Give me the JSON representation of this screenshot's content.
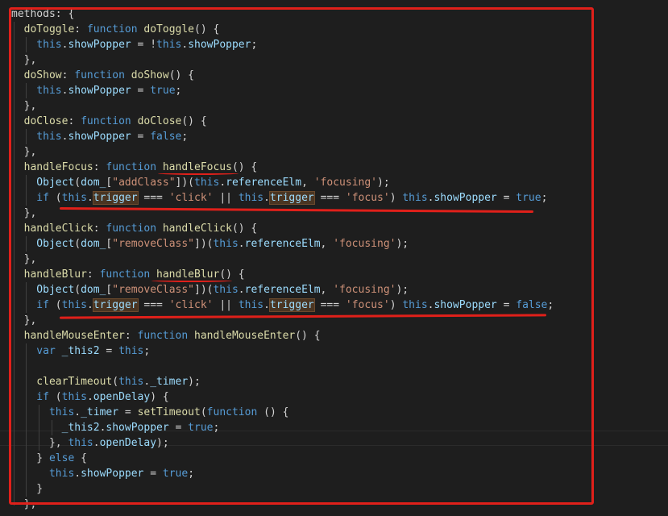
{
  "editor": {
    "lines": [
      [
        {
          "t": "methods",
          "c": "k-plain"
        },
        {
          "t": ": {",
          "c": "k-plain"
        }
      ],
      [
        {
          "t": "  doToggle",
          "c": "k-fn"
        },
        {
          "t": ": ",
          "c": "k-plain"
        },
        {
          "t": "function ",
          "c": "k-kw"
        },
        {
          "t": "doToggle",
          "c": "k-fn"
        },
        {
          "t": "() {",
          "c": "k-plain"
        }
      ],
      [
        {
          "t": "    this",
          "c": "k-kw"
        },
        {
          "t": ".",
          "c": "k-plain"
        },
        {
          "t": "showPopper",
          "c": "k-prop"
        },
        {
          "t": " = !",
          "c": "k-plain"
        },
        {
          "t": "this",
          "c": "k-kw"
        },
        {
          "t": ".",
          "c": "k-plain"
        },
        {
          "t": "showPopper",
          "c": "k-prop"
        },
        {
          "t": ";",
          "c": "k-plain"
        }
      ],
      [
        {
          "t": "  },",
          "c": "k-plain"
        }
      ],
      [
        {
          "t": "  doShow",
          "c": "k-fn"
        },
        {
          "t": ": ",
          "c": "k-plain"
        },
        {
          "t": "function ",
          "c": "k-kw"
        },
        {
          "t": "doShow",
          "c": "k-fn"
        },
        {
          "t": "() {",
          "c": "k-plain"
        }
      ],
      [
        {
          "t": "    this",
          "c": "k-kw"
        },
        {
          "t": ".",
          "c": "k-plain"
        },
        {
          "t": "showPopper",
          "c": "k-prop"
        },
        {
          "t": " = ",
          "c": "k-plain"
        },
        {
          "t": "true",
          "c": "k-lit"
        },
        {
          "t": ";",
          "c": "k-plain"
        }
      ],
      [
        {
          "t": "  },",
          "c": "k-plain"
        }
      ],
      [
        {
          "t": "  doClose",
          "c": "k-fn"
        },
        {
          "t": ": ",
          "c": "k-plain"
        },
        {
          "t": "function ",
          "c": "k-kw"
        },
        {
          "t": "doClose",
          "c": "k-fn"
        },
        {
          "t": "() {",
          "c": "k-plain"
        }
      ],
      [
        {
          "t": "    this",
          "c": "k-kw"
        },
        {
          "t": ".",
          "c": "k-plain"
        },
        {
          "t": "showPopper",
          "c": "k-prop"
        },
        {
          "t": " = ",
          "c": "k-plain"
        },
        {
          "t": "false",
          "c": "k-lit"
        },
        {
          "t": ";",
          "c": "k-plain"
        }
      ],
      [
        {
          "t": "  },",
          "c": "k-plain"
        }
      ],
      [
        {
          "t": "  handleFocus",
          "c": "k-fn"
        },
        {
          "t": ": ",
          "c": "k-plain"
        },
        {
          "t": "function ",
          "c": "k-kw"
        },
        {
          "t": "handleFocus",
          "c": "k-fn"
        },
        {
          "t": "() {",
          "c": "k-plain"
        }
      ],
      [
        {
          "t": "    Object",
          "c": "k-prop"
        },
        {
          "t": "(",
          "c": "k-plain"
        },
        {
          "t": "dom_",
          "c": "k-prop"
        },
        {
          "t": "[",
          "c": "k-plain"
        },
        {
          "t": "\"addClass\"",
          "c": "k-str"
        },
        {
          "t": "])(",
          "c": "k-plain"
        },
        {
          "t": "this",
          "c": "k-kw"
        },
        {
          "t": ".",
          "c": "k-plain"
        },
        {
          "t": "referenceElm",
          "c": "k-prop"
        },
        {
          "t": ", ",
          "c": "k-plain"
        },
        {
          "t": "'focusing'",
          "c": "k-str"
        },
        {
          "t": ");",
          "c": "k-plain"
        }
      ],
      [
        {
          "t": "    if ",
          "c": "k-kw"
        },
        {
          "t": "(",
          "c": "k-plain"
        },
        {
          "t": "this",
          "c": "k-kw"
        },
        {
          "t": ".",
          "c": "k-plain"
        },
        {
          "t": "trigger",
          "c": "k-prop hl"
        },
        {
          "t": " === ",
          "c": "k-plain"
        },
        {
          "t": "'click'",
          "c": "k-str"
        },
        {
          "t": " || ",
          "c": "k-plain"
        },
        {
          "t": "this",
          "c": "k-kw"
        },
        {
          "t": ".",
          "c": "k-plain"
        },
        {
          "t": "trigger",
          "c": "k-prop hl"
        },
        {
          "t": " === ",
          "c": "k-plain"
        },
        {
          "t": "'focus'",
          "c": "k-str"
        },
        {
          "t": ") ",
          "c": "k-plain"
        },
        {
          "t": "this",
          "c": "k-kw"
        },
        {
          "t": ".",
          "c": "k-plain"
        },
        {
          "t": "showPopper",
          "c": "k-prop"
        },
        {
          "t": " = ",
          "c": "k-plain"
        },
        {
          "t": "true",
          "c": "k-lit"
        },
        {
          "t": ";",
          "c": "k-plain"
        }
      ],
      [
        {
          "t": "  },",
          "c": "k-plain"
        }
      ],
      [
        {
          "t": "  handleClick",
          "c": "k-fn"
        },
        {
          "t": ": ",
          "c": "k-plain"
        },
        {
          "t": "function ",
          "c": "k-kw"
        },
        {
          "t": "handleClick",
          "c": "k-fn"
        },
        {
          "t": "() {",
          "c": "k-plain"
        }
      ],
      [
        {
          "t": "    Object",
          "c": "k-prop"
        },
        {
          "t": "(",
          "c": "k-plain"
        },
        {
          "t": "dom_",
          "c": "k-prop"
        },
        {
          "t": "[",
          "c": "k-plain"
        },
        {
          "t": "\"removeClass\"",
          "c": "k-str"
        },
        {
          "t": "])(",
          "c": "k-plain"
        },
        {
          "t": "this",
          "c": "k-kw"
        },
        {
          "t": ".",
          "c": "k-plain"
        },
        {
          "t": "referenceElm",
          "c": "k-prop"
        },
        {
          "t": ", ",
          "c": "k-plain"
        },
        {
          "t": "'focusing'",
          "c": "k-str"
        },
        {
          "t": ");",
          "c": "k-plain"
        }
      ],
      [
        {
          "t": "  },",
          "c": "k-plain"
        }
      ],
      [
        {
          "t": "  handleBlur",
          "c": "k-fn"
        },
        {
          "t": ": ",
          "c": "k-plain"
        },
        {
          "t": "function ",
          "c": "k-kw"
        },
        {
          "t": "handleBlur",
          "c": "k-fn"
        },
        {
          "t": "() {",
          "c": "k-plain"
        }
      ],
      [
        {
          "t": "    Object",
          "c": "k-prop"
        },
        {
          "t": "(",
          "c": "k-plain"
        },
        {
          "t": "dom_",
          "c": "k-prop"
        },
        {
          "t": "[",
          "c": "k-plain"
        },
        {
          "t": "\"removeClass\"",
          "c": "k-str"
        },
        {
          "t": "])(",
          "c": "k-plain"
        },
        {
          "t": "this",
          "c": "k-kw"
        },
        {
          "t": ".",
          "c": "k-plain"
        },
        {
          "t": "referenceElm",
          "c": "k-prop"
        },
        {
          "t": ", ",
          "c": "k-plain"
        },
        {
          "t": "'focusing'",
          "c": "k-str"
        },
        {
          "t": ");",
          "c": "k-plain"
        }
      ],
      [
        {
          "t": "    if ",
          "c": "k-kw"
        },
        {
          "t": "(",
          "c": "k-plain"
        },
        {
          "t": "this",
          "c": "k-kw"
        },
        {
          "t": ".",
          "c": "k-plain"
        },
        {
          "t": "trigger",
          "c": "k-prop hl"
        },
        {
          "t": " === ",
          "c": "k-plain"
        },
        {
          "t": "'click'",
          "c": "k-str"
        },
        {
          "t": " || ",
          "c": "k-plain"
        },
        {
          "t": "this",
          "c": "k-kw"
        },
        {
          "t": ".",
          "c": "k-plain"
        },
        {
          "t": "trigger",
          "c": "k-prop hl"
        },
        {
          "t": " === ",
          "c": "k-plain"
        },
        {
          "t": "'focus'",
          "c": "k-str"
        },
        {
          "t": ") ",
          "c": "k-plain"
        },
        {
          "t": "this",
          "c": "k-kw"
        },
        {
          "t": ".",
          "c": "k-plain"
        },
        {
          "t": "showPopper",
          "c": "k-prop"
        },
        {
          "t": " = ",
          "c": "k-plain"
        },
        {
          "t": "false",
          "c": "k-lit"
        },
        {
          "t": ";",
          "c": "k-plain"
        }
      ],
      [
        {
          "t": "  },",
          "c": "k-plain"
        }
      ],
      [
        {
          "t": "  handleMouseEnter",
          "c": "k-fn"
        },
        {
          "t": ": ",
          "c": "k-plain"
        },
        {
          "t": "function ",
          "c": "k-kw"
        },
        {
          "t": "handleMouseEnter",
          "c": "k-fn"
        },
        {
          "t": "() {",
          "c": "k-plain"
        }
      ],
      [
        {
          "t": "    var ",
          "c": "k-kw"
        },
        {
          "t": "_this2",
          "c": "k-prop"
        },
        {
          "t": " = ",
          "c": "k-plain"
        },
        {
          "t": "this",
          "c": "k-kw"
        },
        {
          "t": ";",
          "c": "k-plain"
        }
      ],
      [
        {
          "t": "",
          "c": "k-plain"
        }
      ],
      [
        {
          "t": "    clearTimeout",
          "c": "k-fn"
        },
        {
          "t": "(",
          "c": "k-plain"
        },
        {
          "t": "this",
          "c": "k-kw"
        },
        {
          "t": ".",
          "c": "k-plain"
        },
        {
          "t": "_timer",
          "c": "k-prop"
        },
        {
          "t": ");",
          "c": "k-plain"
        }
      ],
      [
        {
          "t": "    if ",
          "c": "k-kw"
        },
        {
          "t": "(",
          "c": "k-plain"
        },
        {
          "t": "this",
          "c": "k-kw"
        },
        {
          "t": ".",
          "c": "k-plain"
        },
        {
          "t": "openDelay",
          "c": "k-prop"
        },
        {
          "t": ") {",
          "c": "k-plain"
        }
      ],
      [
        {
          "t": "      this",
          "c": "k-kw"
        },
        {
          "t": ".",
          "c": "k-plain"
        },
        {
          "t": "_timer",
          "c": "k-prop"
        },
        {
          "t": " = ",
          "c": "k-plain"
        },
        {
          "t": "setTimeout",
          "c": "k-fn"
        },
        {
          "t": "(",
          "c": "k-plain"
        },
        {
          "t": "function ",
          "c": "k-kw"
        },
        {
          "t": "() {",
          "c": "k-plain"
        }
      ],
      [
        {
          "t": "        _this2",
          "c": "k-prop"
        },
        {
          "t": ".",
          "c": "k-plain"
        },
        {
          "t": "showPopper",
          "c": "k-prop"
        },
        {
          "t": " = ",
          "c": "k-plain"
        },
        {
          "t": "true",
          "c": "k-lit"
        },
        {
          "t": ";",
          "c": "k-plain"
        }
      ],
      [
        {
          "t": "      }, ",
          "c": "k-plain"
        },
        {
          "t": "this",
          "c": "k-kw"
        },
        {
          "t": ".",
          "c": "k-plain"
        },
        {
          "t": "openDelay",
          "c": "k-prop"
        },
        {
          "t": ");",
          "c": "k-plain"
        }
      ],
      [
        {
          "t": "    } ",
          "c": "k-plain"
        },
        {
          "t": "else ",
          "c": "k-kw"
        },
        {
          "t": "{",
          "c": "k-plain"
        }
      ],
      [
        {
          "t": "      this",
          "c": "k-kw"
        },
        {
          "t": ".",
          "c": "k-plain"
        },
        {
          "t": "showPopper",
          "c": "k-prop"
        },
        {
          "t": " = ",
          "c": "k-plain"
        },
        {
          "t": "true",
          "c": "k-lit"
        },
        {
          "t": ";",
          "c": "k-plain"
        }
      ],
      [
        {
          "t": "    }",
          "c": "k-plain"
        }
      ],
      [
        {
          "t": "  },",
          "c": "k-plain"
        }
      ]
    ]
  },
  "colors": {
    "background": "#1e1e1e",
    "annotation": "#e0201a",
    "keyword": "#569cd6",
    "function": "#dcdcaa",
    "property": "#9cdcfe",
    "string": "#ce9178"
  }
}
